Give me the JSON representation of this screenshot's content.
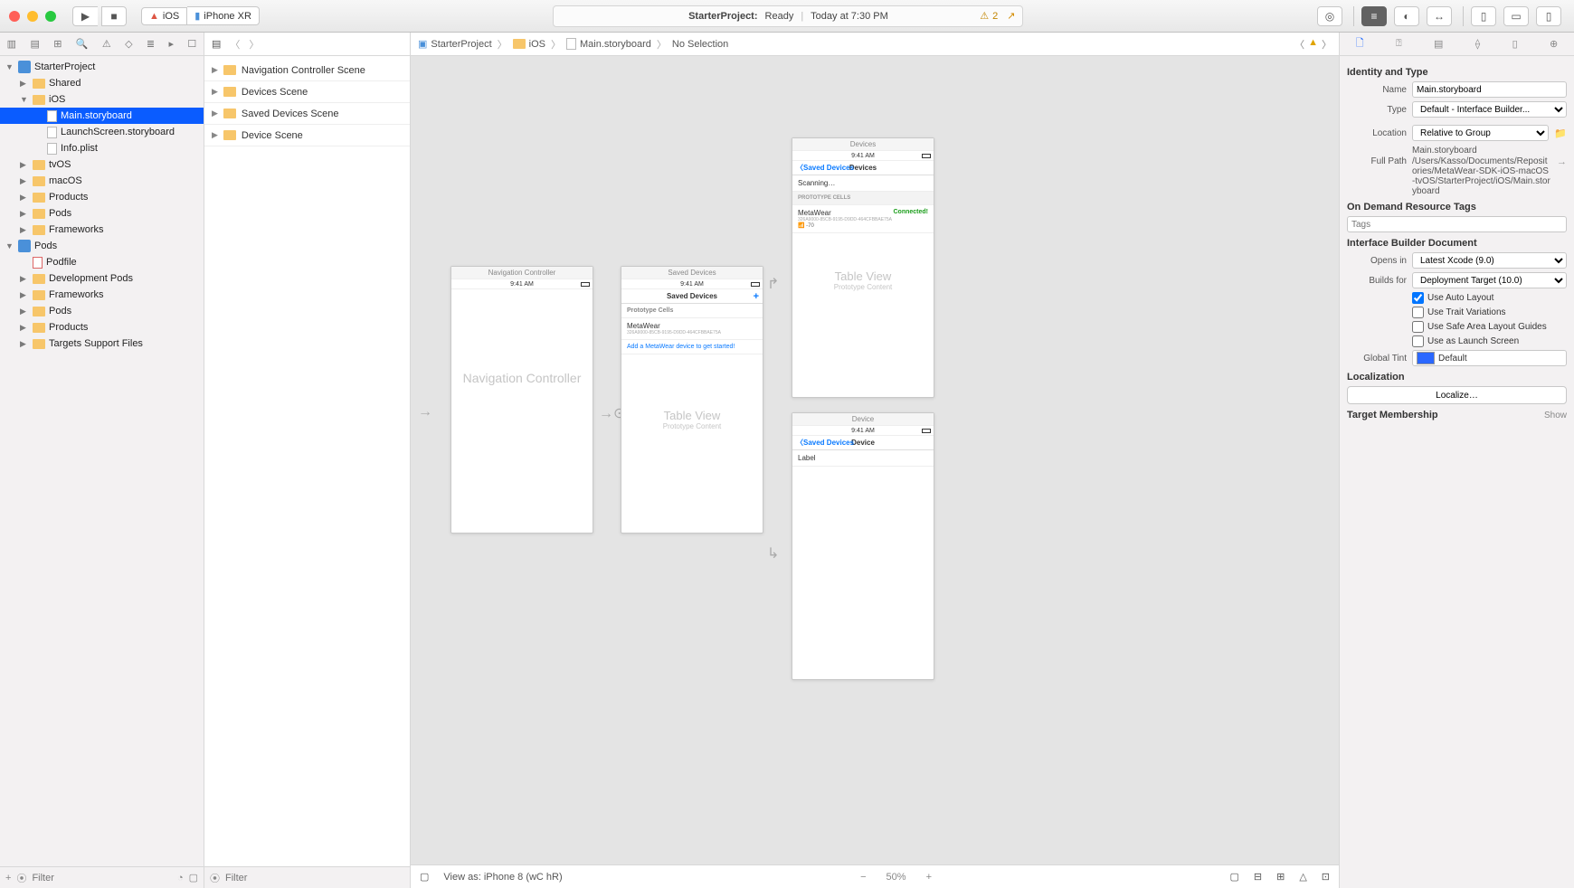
{
  "titlebar": {
    "scheme_left": "iOS",
    "scheme_right": "iPhone XR",
    "status_main": "StarterProject:",
    "status_state": "Ready",
    "status_time": "Today at 7:30 PM",
    "warning_count": "2"
  },
  "navigator": {
    "project": "StarterProject",
    "items": [
      {
        "label": "Shared",
        "indent": 1,
        "kind": "folder",
        "disc": "▶"
      },
      {
        "label": "iOS",
        "indent": 1,
        "kind": "folder",
        "disc": "▼"
      },
      {
        "label": "Main.storyboard",
        "indent": 2,
        "kind": "sb",
        "sel": true
      },
      {
        "label": "LaunchScreen.storyboard",
        "indent": 2,
        "kind": "sb"
      },
      {
        "label": "Info.plist",
        "indent": 2,
        "kind": "file"
      },
      {
        "label": "tvOS",
        "indent": 1,
        "kind": "folder",
        "disc": "▶"
      },
      {
        "label": "macOS",
        "indent": 1,
        "kind": "folder",
        "disc": "▶"
      },
      {
        "label": "Products",
        "indent": 1,
        "kind": "folder",
        "disc": "▶"
      },
      {
        "label": "Pods",
        "indent": 1,
        "kind": "folder",
        "disc": "▶"
      },
      {
        "label": "Frameworks",
        "indent": 1,
        "kind": "folder",
        "disc": "▶"
      }
    ],
    "pods": {
      "label": "Pods",
      "items": [
        {
          "label": "Podfile",
          "kind": "file"
        },
        {
          "label": "Development Pods",
          "kind": "folder",
          "disc": "▶"
        },
        {
          "label": "Frameworks",
          "kind": "folder",
          "disc": "▶"
        },
        {
          "label": "Pods",
          "kind": "folder",
          "disc": "▶"
        },
        {
          "label": "Products",
          "kind": "folder",
          "disc": "▶"
        },
        {
          "label": "Targets Support Files",
          "kind": "folder",
          "disc": "▶"
        }
      ]
    },
    "filter_placeholder": "Filter"
  },
  "outline": {
    "scenes": [
      "Navigation Controller Scene",
      "Devices Scene",
      "Saved Devices Scene",
      "Device Scene"
    ],
    "filter_placeholder": "Filter"
  },
  "jumpbar": {
    "items": [
      "StarterProject",
      "iOS",
      "Main.storyboard",
      "No Selection"
    ]
  },
  "canvas": {
    "nav_controller": {
      "caption": "Navigation Controller",
      "time": "9:41 AM",
      "placeholder": "Navigation Controller"
    },
    "saved_devices": {
      "caption": "Saved Devices",
      "time": "9:41 AM",
      "title": "Saved Devices",
      "proto": "Prototype Cells",
      "cell": "MetaWear",
      "cell_sub": "326A9000-85CB-9195-D9DD-464CFBBAE75A",
      "add": "Add a MetaWear device to get started!",
      "tv": "Table View",
      "tvs": "Prototype Content"
    },
    "devices": {
      "caption": "Devices",
      "time": "9:41 AM",
      "back": "Saved Devices",
      "title": "Devices",
      "scanning": "Scanning…",
      "proto": "PROTOTYPE CELLS",
      "cell": "MetaWear",
      "cell_state": "Connected!",
      "cell_sub": "326A9000-85CB-9195-D9DD-464CFBBAE75A",
      "rssi": "-70",
      "tv": "Table View",
      "tvs": "Prototype Content"
    },
    "device": {
      "caption": "Device",
      "time": "9:41 AM",
      "back": "Saved Devices",
      "title": "Device",
      "label": "Label"
    }
  },
  "bottom": {
    "view_as": "View as: iPhone 8 (wC hR)",
    "zoom": "50%"
  },
  "inspector": {
    "identity_title": "Identity and Type",
    "name_label": "Name",
    "name_value": "Main.storyboard",
    "type_label": "Type",
    "type_value": "Default - Interface Builder...",
    "location_label": "Location",
    "location_value": "Relative to Group",
    "location_sub": "Main.storyboard",
    "fullpath_label": "Full Path",
    "fullpath_value": "/Users/Kasso/Documents/Repositories/MetaWear-SDK-iOS-macOS-tvOS/StarterProject/iOS/Main.storyboard",
    "odr_title": "On Demand Resource Tags",
    "odr_placeholder": "Tags",
    "ib_title": "Interface Builder Document",
    "opens_label": "Opens in",
    "opens_value": "Latest Xcode (9.0)",
    "builds_label": "Builds for",
    "builds_value": "Deployment Target (10.0)",
    "chk_auto": "Use Auto Layout",
    "chk_trait": "Use Trait Variations",
    "chk_safe": "Use Safe Area Layout Guides",
    "chk_launch": "Use as Launch Screen",
    "tint_label": "Global Tint",
    "tint_value": "Default",
    "loc_title": "Localization",
    "loc_btn": "Localize…",
    "target_title": "Target Membership",
    "target_show": "Show"
  }
}
